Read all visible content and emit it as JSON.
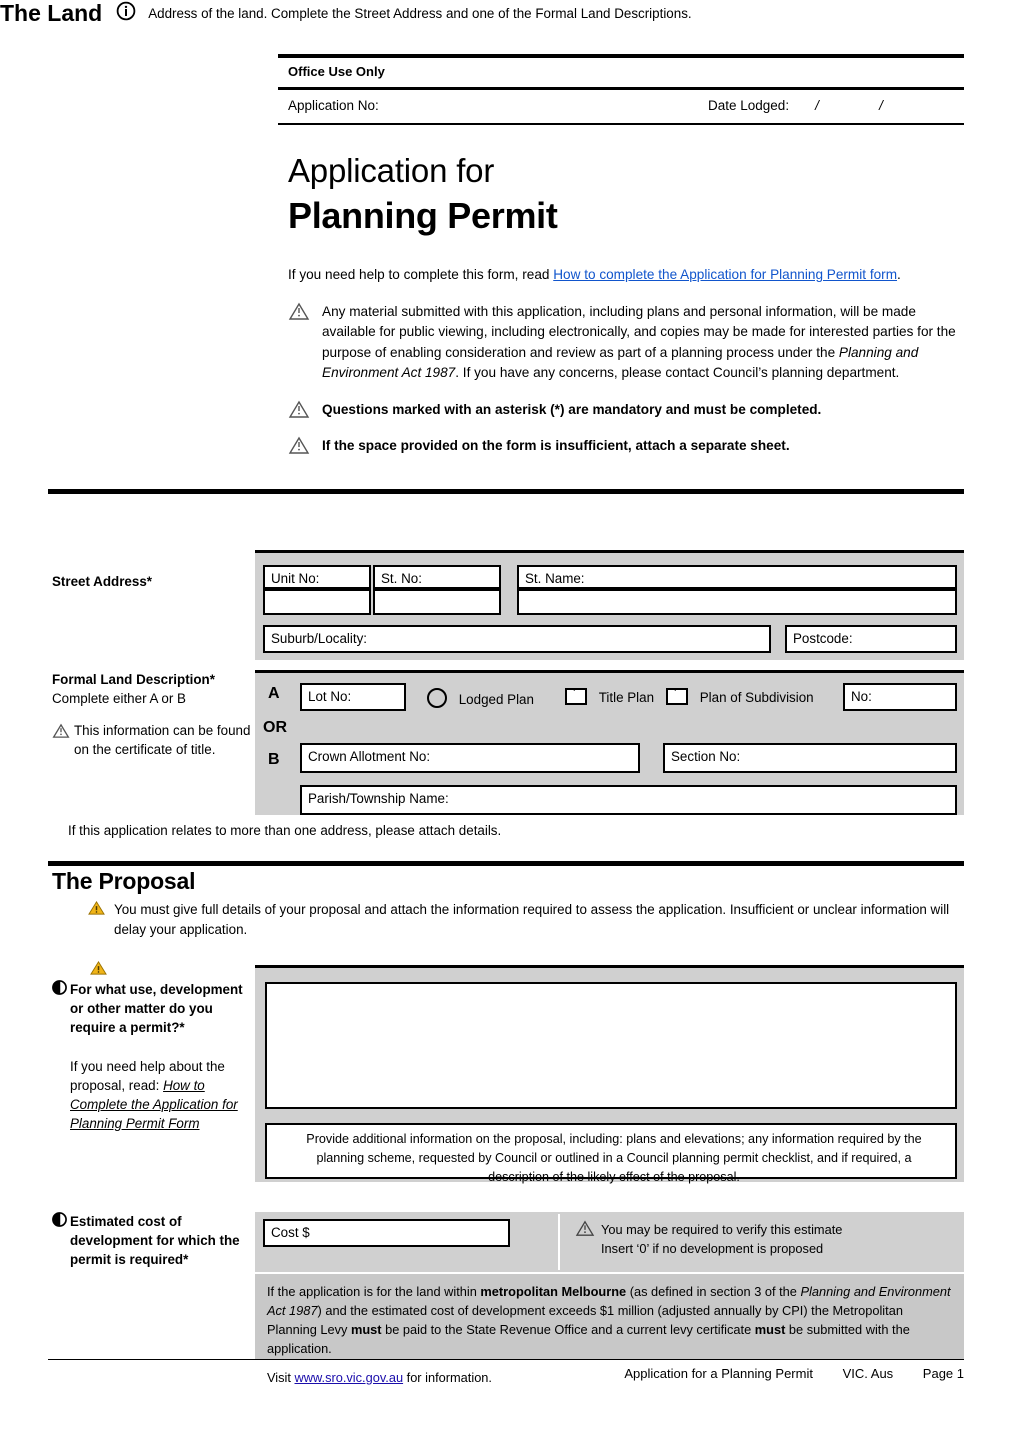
{
  "office": {
    "title": "Office Use Only",
    "application_no_label": "Application No:",
    "date_lodged_label": "Date Lodged:",
    "slash1": "/",
    "slash2": "/"
  },
  "header": {
    "title_line1": "Application for",
    "title_line2": "Planning Permit"
  },
  "intro": {
    "help_prefix": "If you need help to complete this form, read ",
    "help_link": "How to complete the Application for Planning Permit form",
    "help_suffix": ".",
    "note1_a": "Any material submitted with this application, including plans and personal information, will be made available for public viewing, including electronically, and copies may be made for interested parties for the purpose of enabling consideration and review as part of a planning process under the ",
    "note1_em": "Planning and Environment Act 1987",
    "note1_b": ". If you have any concerns, please contact Council’s planning department.",
    "note2": "Questions marked with an asterisk (*) are mandatory and must be completed.",
    "note3": "If the space provided on the form is insufficient, attach a separate sheet."
  },
  "land": {
    "heading": "The Land",
    "subtitle": "Address of the land. Complete the Street Address and one of the Formal Land Descriptions.",
    "street_address_label": "Street Address*",
    "unit_no": "Unit No:",
    "st_no": "St. No:",
    "st_name": "St. Name:",
    "suburb": "Suburb/Locality:",
    "postcode": "Postcode:",
    "formal_label": "Formal Land Description*",
    "formal_sub": "Complete either A or B",
    "formal_note": "This information can be found on the certificate of title.",
    "a": "A",
    "or": "OR",
    "b": "B",
    "lot_no": "Lot No:",
    "lodged_plan": "Lodged Plan",
    "title_plan": "Title Plan",
    "plan_of_subdivision": "Plan of Subdivision",
    "no": "No:",
    "crown_allotment": "Crown Allotment No:",
    "section_no": "Section No:",
    "parish": "Parish/Township Name:",
    "more_than_one": "If this application relates to more than one address, please attach details."
  },
  "proposal": {
    "heading": "The Proposal",
    "warning": "You must give full details of your proposal and attach the information required to assess the application. Insufficient or unclear information will delay your application.",
    "q1_line1": "For what use, development",
    "q1_line2": "or other matter do you",
    "q1_line3": "require a permit?*",
    "q1_help_a": "If you need help about the proposal, read: ",
    "q1_help_em": "How to Complete the Application for Planning Permit Form",
    "additional_info": "Provide additional information on the proposal, including: plans and elevations; any information required by the planning scheme, requested by Council or outlined in a Council planning permit checklist, and if required, a description of the likely effect of the proposal.",
    "cost_q_line1": "Estimated cost of",
    "cost_q_line2": "development for which the",
    "cost_q_line3": "permit is required*",
    "cost_field": "Cost $",
    "verify_line1": "You may be required to verify this estimate",
    "verify_line2": "Insert ‘0’ if no development is proposed",
    "levy_a": "If the application is for the land within ",
    "levy_bold1": "metropolitan Melbourne",
    "levy_b": " (as defined in section 3 of the ",
    "levy_em1": "Planning and Environment Act 1987",
    "levy_c": ") and the estimated cost of development exceeds $1 million (adjusted annually by CPI) the Metropolitan Planning Levy ",
    "levy_bold2": "must",
    "levy_d": " be paid to the State Revenue Office and a current levy certificate ",
    "levy_bold3": "must",
    "levy_e": " be submitted with the application.",
    "visit_a": "Visit ",
    "visit_link": "www.sro.vic.gov.au",
    "visit_b": " for information."
  },
  "footer": {
    "doc_title": "Application for a Planning Permit",
    "region": "VIC. Aus",
    "page": "Page 1"
  },
  "colors": {
    "link": "#1155cc",
    "table_grey": "#d0d0d0",
    "band_grey": "#c8c8c8",
    "warning_yellow": "#f0b418"
  }
}
